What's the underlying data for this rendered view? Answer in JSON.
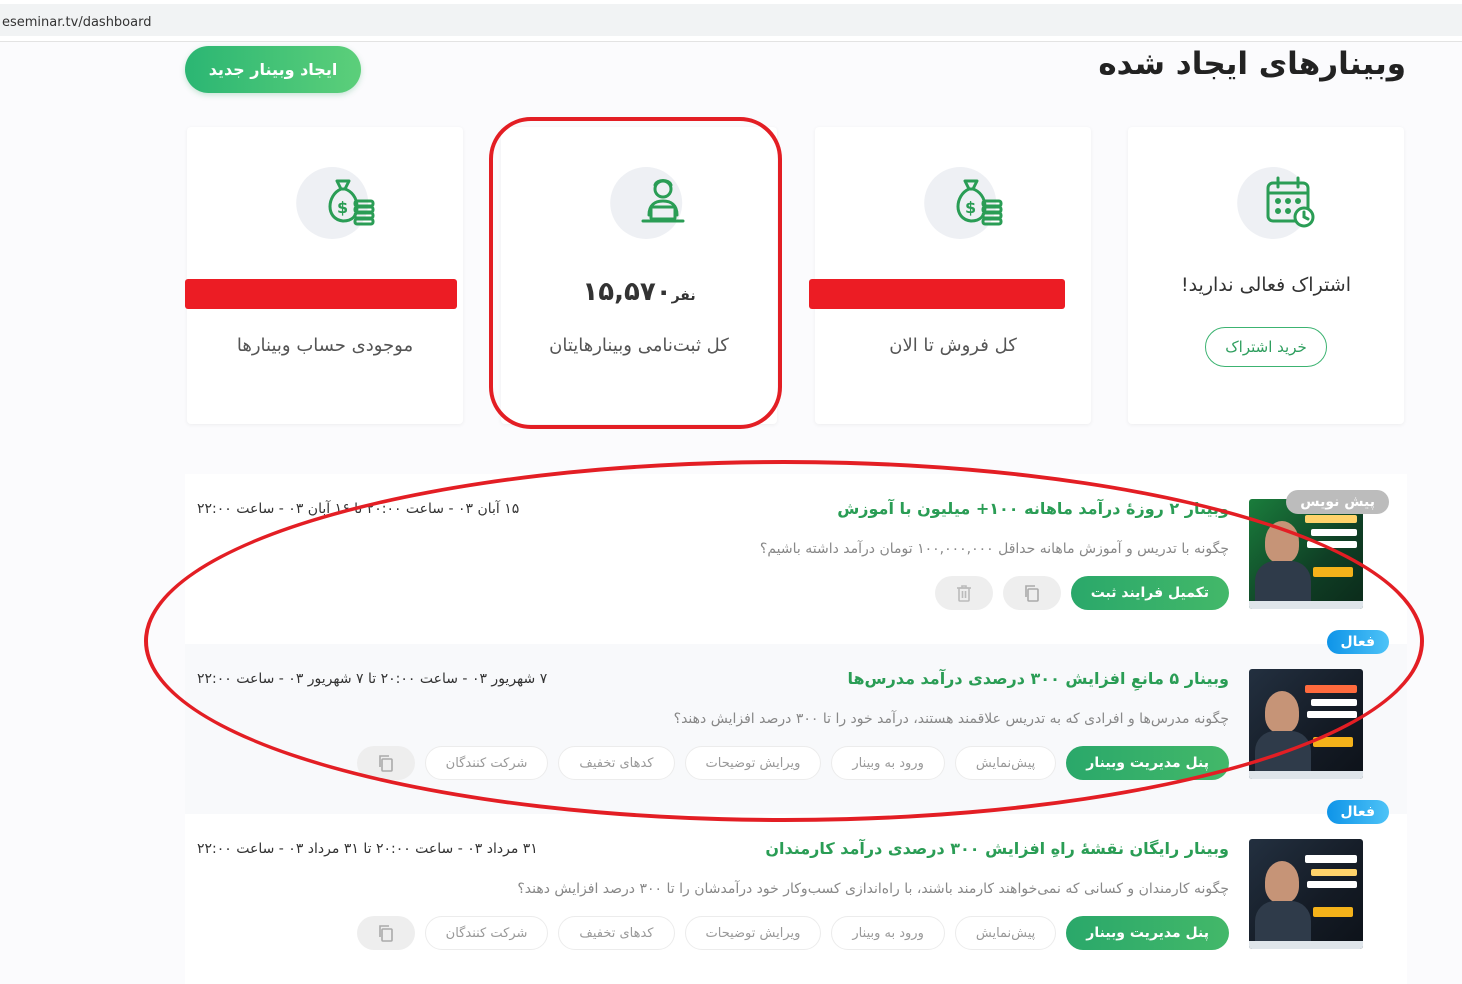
{
  "browser": {
    "url": "eseminar.tv/dashboard"
  },
  "header": {
    "title": "وبینارهای ایجاد شده",
    "new_button": "ایجاد وبینار جدید"
  },
  "cards": {
    "balance": {
      "label": "موجودی حساب وبینارها"
    },
    "registrations": {
      "value": "۱۵,۵۷۰",
      "unit": "نفر",
      "label": "کل ثبت‌نامی وبینارهایتان"
    },
    "sales": {
      "label": "کل فروش تا الان"
    },
    "subscription": {
      "message": "اشتراک فعالی ندارید!",
      "button": "خرید اشتراک"
    }
  },
  "webinars": [
    {
      "badge": "پیش نویس",
      "title": "وبینار ۲ روزۀ درآمد ماهانه ۱۰۰+ میلیون با آموزش",
      "date": "۱۵ آبان ۰۳ - ساعت ۲۰:۰۰ تا ۱۶ آبان ۰۳ - ساعت ۲۲:۰۰",
      "description": "چگونه با تدریس و آموزش ماهانه حداقل ۱۰۰,۰۰۰,۰۰۰ تومان درآمد داشته باشیم؟",
      "primary_action": "تکمیل فرایند ثبت"
    },
    {
      "badge": "فعال",
      "title": "وبینار ۵ مانعِ افزایش ۳۰۰ درصدی درآمد مدرس‌ها",
      "date": "۷ شهریور ۰۳ - ساعت ۲۰:۰۰ تا ۷ شهریور ۰۳ - ساعت ۲۲:۰۰",
      "description": "چگونه مدرس‌ها و افرادی که به تدریس علاقمند هستند، درآمد خود را تا ۳۰۰ درصد افزایش دهند؟",
      "primary_action": "پنل مدیریت وبینار",
      "actions": [
        "پیش‌نمایش",
        "ورود به وبینار",
        "ویرایش توضیحات",
        "کدهای تخفیف",
        "شرکت کنندگان"
      ]
    },
    {
      "badge": "فعال",
      "title": "وبینار رایگان نقشهٔ راهِ افزایش ۳۰۰ درصدی درآمد کارمندان",
      "date": "۳۱ مرداد ۰۳ - ساعت ۲۰:۰۰ تا ۳۱ مرداد ۰۳ - ساعت ۲۲:۰۰",
      "description": "چگونه کارمندان و کسانی که نمی‌خواهند کارمند باشند، با راه‌اندازی کسب‌وکار خود درآمدشان را تا ۳۰۰ درصد افزایش دهند؟",
      "primary_action": "پنل مدیریت وبینار",
      "actions": [
        "پیش‌نمایش",
        "ورود به وبینار",
        "ویرایش توضیحات",
        "کدهای تخفیف",
        "شرکت کنندگان"
      ]
    }
  ],
  "colors": {
    "accent": "#2a9d55",
    "annotation": "#e31e24",
    "badge_active": "#0e94e8",
    "badge_draft": "#bcbcbc"
  }
}
